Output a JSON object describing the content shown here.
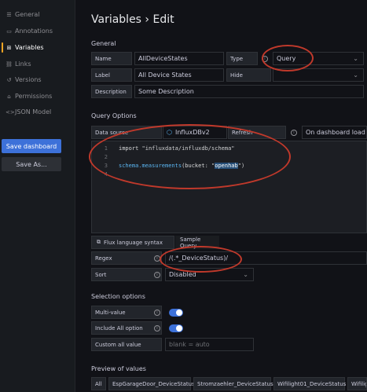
{
  "sidebar": {
    "items": [
      {
        "label": "General",
        "icon": "sliders-icon"
      },
      {
        "label": "Annotations",
        "icon": "comment-icon"
      },
      {
        "label": "Variables",
        "icon": "variables-icon",
        "active": true
      },
      {
        "label": "Links",
        "icon": "link-icon"
      },
      {
        "label": "Versions",
        "icon": "history-icon"
      },
      {
        "label": "Permissions",
        "icon": "lock-icon"
      },
      {
        "label": "JSON Model",
        "icon": "code-icon"
      }
    ],
    "save_label": "Save dashboard",
    "save_as_label": "Save As..."
  },
  "page": {
    "title": "Variables › Edit"
  },
  "general": {
    "section": "General",
    "name_label": "Name",
    "name_value": "AllDeviceStates",
    "type_label": "Type",
    "type_value": "Query",
    "label_label": "Label",
    "label_value": "All Device States",
    "hide_label": "Hide",
    "hide_value": "",
    "desc_label": "Description",
    "desc_value": "Some Description"
  },
  "query": {
    "section": "Query Options",
    "ds_label": "Data source",
    "ds_value": "InfluxDBv2",
    "refresh_label": "Refresh",
    "refresh_value": "On dashboard load",
    "lines": {
      "n1": "1",
      "n2": "2",
      "n3": "3",
      "n4": "4",
      "l1a": "import ",
      "l1b": "\"influxdata/influxdb/schema\"",
      "l3a": "schema.measurements",
      "l3b": "(bucket: ",
      "l3c": "\"",
      "l3d": "openhab",
      "l3e": "\")"
    },
    "flux_tab": "Flux language syntax",
    "sample_tab": "Sample Query",
    "regex_label": "Regex",
    "regex_value": "/(.*_DeviceStatus)/",
    "sort_label": "Sort",
    "sort_value": "Disabled"
  },
  "selection": {
    "section": "Selection options",
    "multi_label": "Multi-value",
    "multi_on": true,
    "include_label": "Include All option",
    "include_on": true,
    "custom_label": "Custom all value",
    "custom_placeholder": "blank = auto"
  },
  "preview": {
    "section": "Preview of values",
    "values": [
      "All",
      "EspGarageDoor_DeviceStatus",
      "Stromzaehler_DeviceStatus",
      "Wifilight01_DeviceStatus",
      "Wifiligh"
    ]
  },
  "colors": {
    "accent": "#3d71d9",
    "annotation": "#c0392b",
    "active_marker": "#f5a623"
  }
}
